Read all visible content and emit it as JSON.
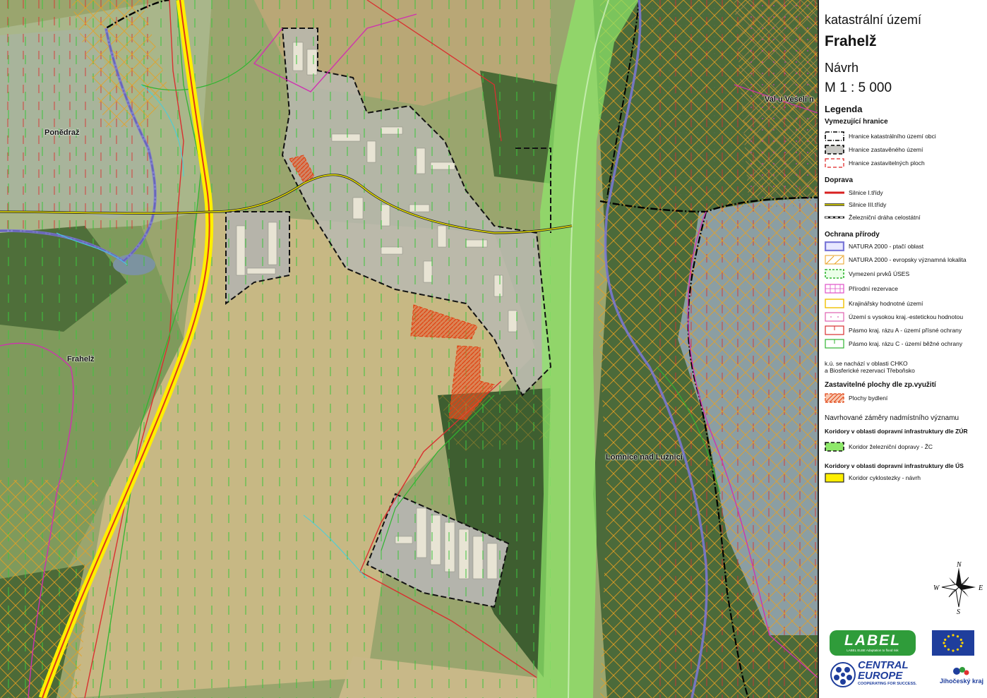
{
  "title": {
    "line1": "katastrální území",
    "name": "Frahelž",
    "line3": "Návrh",
    "scale": "M 1 : 5 000"
  },
  "legend": {
    "heading": "Legenda",
    "sections": {
      "boundaries": {
        "title": "Vymezující hranice",
        "items": [
          {
            "label": "Hranice katastrálního území obci",
            "icon": "cadastral-boundary-symbol"
          },
          {
            "label": "Hranice zastavěného území",
            "icon": "built-up-boundary-symbol"
          },
          {
            "label": "Hranice zastavitelných ploch",
            "icon": "buildable-boundary-symbol"
          }
        ]
      },
      "transport": {
        "title": "Doprava",
        "items": [
          {
            "label": "Silnice I.třídy",
            "icon": "road-class1-symbol"
          },
          {
            "label": "Silnice III.třídy",
            "icon": "road-class3-symbol"
          },
          {
            "label": "Železniční dráha celostátní",
            "icon": "railway-symbol"
          }
        ]
      },
      "nature": {
        "title": "Ochrana přírody",
        "items": [
          {
            "label": "NATURA 2000 - ptačí oblast",
            "icon": "natura-bird-symbol"
          },
          {
            "label": "NATURA 2000 - evropsky významná lokalita",
            "icon": "natura-site-symbol"
          },
          {
            "label": "Vymezení prvků ÚSES",
            "icon": "uses-symbol"
          },
          {
            "label": "Přírodní rezervace",
            "icon": "reserve-symbol"
          },
          {
            "label": "Krajinářsky hodnotné území",
            "icon": "landscape-value-symbol"
          },
          {
            "label": "Území s vysokou kraj.-estetickou hodnotou",
            "icon": "aesthetic-symbol"
          },
          {
            "label": "Pásmo kraj. rázu A - území přísné ochrany",
            "icon": "zone-a-symbol"
          },
          {
            "label": "Pásmo kraj. rázu C - území běžné ochrany",
            "icon": "zone-c-symbol"
          }
        ],
        "note1": "k.ú. se nachází v oblasti CHKO",
        "note2": "a Biosferické rezervaci Třeboňsko"
      },
      "buildable": {
        "title": "Zastavitelné plochy dle zp.využití",
        "items": [
          {
            "label": "Plochy bydlení",
            "icon": "housing-symbol"
          }
        ]
      },
      "proposed": {
        "title": "Navrhované záměry nadmístního významu",
        "sub1": "Koridory v oblasti dopravní infrastruktury dle ZÚR",
        "items1": [
          {
            "label": "Koridor železniční dopravy - ŽC",
            "icon": "rail-corridor-symbol"
          }
        ],
        "sub2": "Koridory v oblasti dopravní infrastruktury dle ÚS",
        "items2": [
          {
            "label": "Koridor cyklostezky - návrh",
            "icon": "cycle-corridor-symbol"
          }
        ]
      }
    }
  },
  "compass": {
    "n": "N",
    "s": "S",
    "e": "E",
    "w": "W"
  },
  "logos": {
    "label_text": "LABEL",
    "label_sub": "LABEL ELBE Adaptation to flood risk",
    "ce_line1": "CENTRAL",
    "ce_line2": "EUROPE",
    "ce_line3": "COOPERATING FOR SUCCESS.",
    "region": "Jihočeský kraj"
  },
  "places": {
    "ponedraz": "Ponědraž",
    "frahelz": "Frahelž",
    "lomnice": "Lomnice nad Lužnicí",
    "val": "Val u Veseli n"
  },
  "colors": {
    "road1": "#e8e000",
    "corridor": "#8ee86a",
    "housing": "#e8552a",
    "natura": "#7b78d8",
    "zoneA": "#e03030",
    "zoneC": "#31b531",
    "reserve": "#e050c8",
    "aesthetic": "#e060b0",
    "landscape": "#f0c000",
    "water": "#8a9aa0"
  }
}
